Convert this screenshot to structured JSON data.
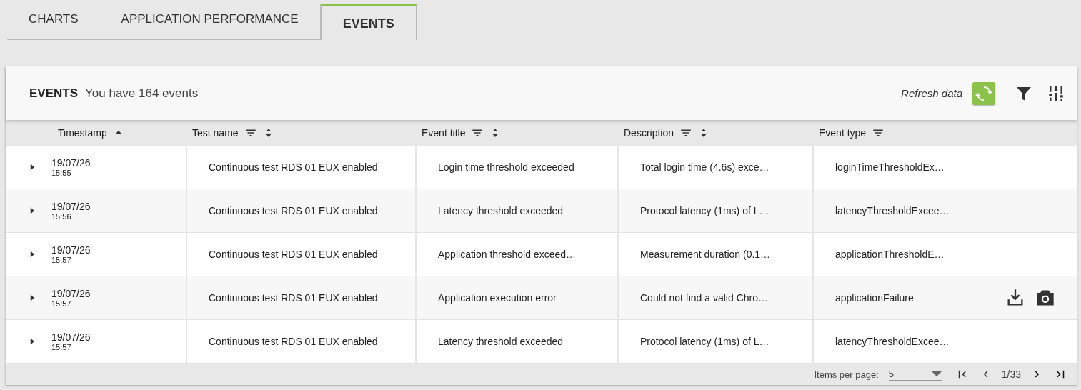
{
  "tabs": [
    {
      "label": "CHARTS",
      "selected": false
    },
    {
      "label": "APPLICATION PERFORMANCE",
      "selected": false
    },
    {
      "label": "EVENTS",
      "selected": true
    }
  ],
  "panel": {
    "title": "EVENTS",
    "subtitle": "You have 164 events",
    "refresh_label": "Refresh data"
  },
  "table": {
    "columns": [
      {
        "label": "Timestamp",
        "filter": false,
        "sortable": true,
        "sorted": true
      },
      {
        "label": "Test name",
        "filter": true,
        "sortable": true,
        "sorted": false
      },
      {
        "label": "Event title",
        "filter": true,
        "sortable": true,
        "sorted": false
      },
      {
        "label": "Description",
        "filter": true,
        "sortable": true,
        "sorted": false
      },
      {
        "label": "Event type",
        "filter": true,
        "sortable": false
      }
    ],
    "rows": [
      {
        "expanded": false,
        "date": "19/07/26",
        "time": "15:55",
        "test_name": "Continuous test RDS 01 EUX enabled",
        "event_title": "Login time threshold exceeded",
        "description": "Total login time (4.6s) exce…",
        "event_type": "loginTimeThresholdEx…",
        "actions": false
      },
      {
        "expanded": false,
        "date": "19/07/26",
        "time": "15:56",
        "test_name": "Continuous test RDS 01 EUX enabled",
        "event_title": "Latency threshold exceeded",
        "description": "Protocol latency (1ms) of L…",
        "event_type": "latencyThresholdExcee…",
        "actions": false
      },
      {
        "expanded": false,
        "date": "19/07/26",
        "time": "15:57",
        "test_name": "Continuous test RDS 01 EUX enabled",
        "event_title": "Application threshold exceed…",
        "description": "Measurement duration (0.1…",
        "event_type": "applicationThresholdE…",
        "actions": false
      },
      {
        "expanded": false,
        "date": "19/07/26",
        "time": "15:57",
        "test_name": "Continuous test RDS 01 EUX enabled",
        "event_title": "Application execution error",
        "description": "Could not find a valid Chro…",
        "event_type": "applicationFailure",
        "actions": true
      },
      {
        "expanded": false,
        "date": "19/07/26",
        "time": "15:57",
        "test_name": "Continuous test RDS 01 EUX enabled",
        "event_title": "Latency threshold exceeded",
        "description": "Protocol latency (1ms) of L…",
        "event_type": "latencyThresholdExcee…",
        "actions": false
      }
    ]
  },
  "paginator": {
    "items_label": "Items per page:",
    "page_size": "5",
    "range": "1/33"
  }
}
